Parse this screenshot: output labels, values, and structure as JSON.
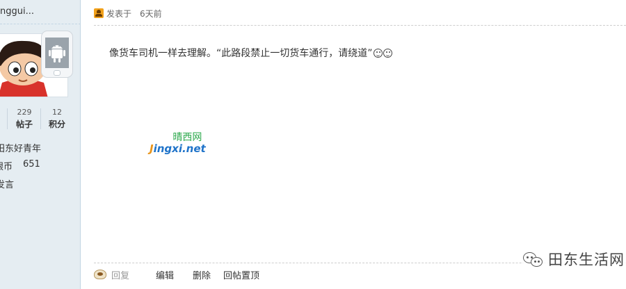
{
  "sidebar": {
    "username": "nggui...",
    "stats": [
      {
        "value": "229",
        "label": "帖子"
      },
      {
        "value": "12",
        "label": "积分"
      }
    ],
    "lines": [
      "田东好青年",
      "银币",
      "651",
      "发言"
    ]
  },
  "post": {
    "meta": {
      "posted_label": "发表于",
      "time": "6天前"
    },
    "body_text": "像货车司机一样去理解。“此路段禁止一切货车通行，请绕道”",
    "actions": {
      "reply": "回复",
      "edit": "编辑",
      "delete": "删除",
      "back_to_top": "回帖置顶"
    }
  },
  "watermark": {
    "cn": "晴西网",
    "en_j": "J",
    "en_rest": "ingxi.net"
  },
  "wechat_badge": {
    "text": "田东生活网"
  },
  "colors": {
    "sidebar_bg": "#e5edf2",
    "accent_blue": "#1f73c9",
    "accent_green": "#2aa84a"
  }
}
